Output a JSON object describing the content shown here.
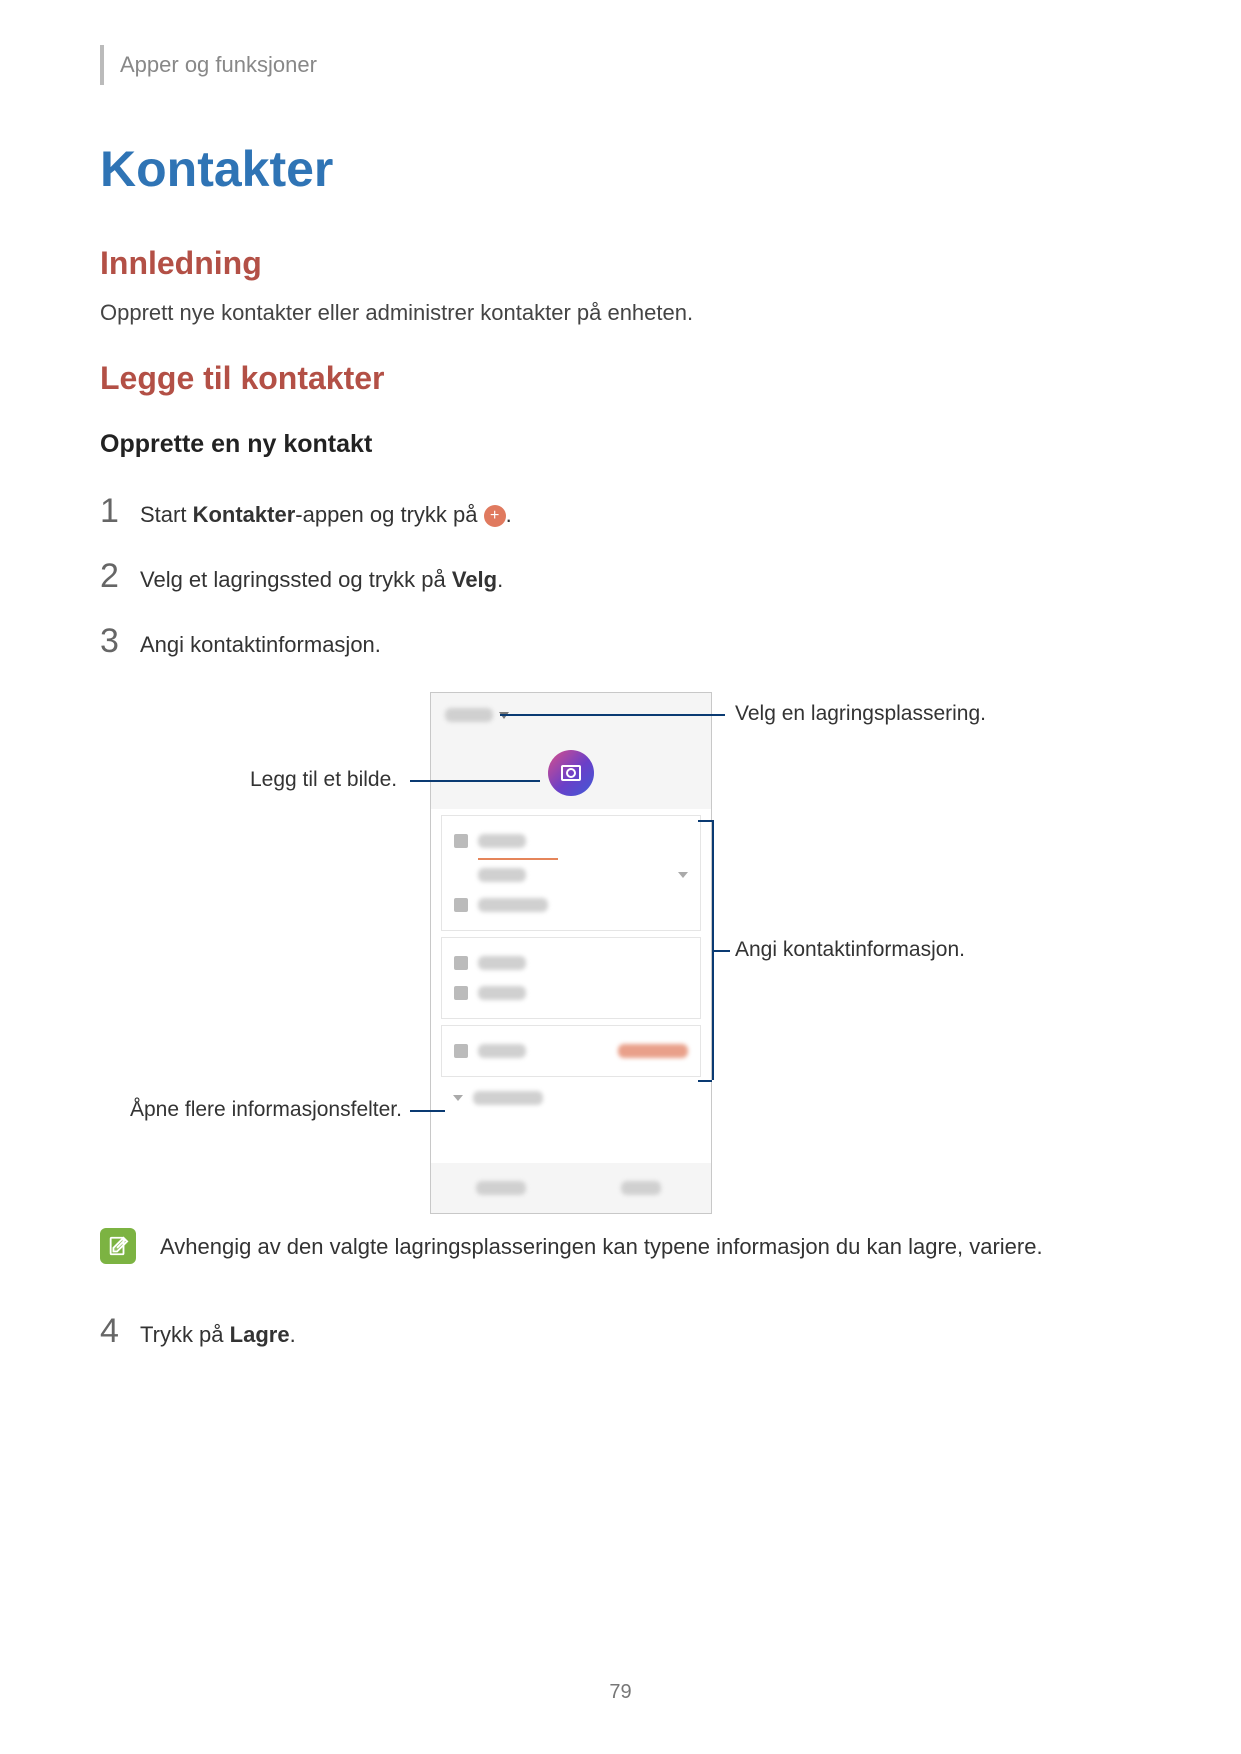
{
  "breadcrumb": "Apper og funksjoner",
  "h1": "Kontakter",
  "section_intro_heading": "Innledning",
  "intro_text": "Opprett nye kontakter eller administrer kontakter på enheten.",
  "section_add_heading": "Legge til kontakter",
  "subsection_create_heading": "Opprette en ny kontakt",
  "steps": {
    "s1_pre": "Start ",
    "s1_bold": "Kontakter",
    "s1_mid": "-appen og trykk på ",
    "s1_post": ".",
    "s2_pre": "Velg et lagringssted og trykk på ",
    "s2_bold": "Velg",
    "s2_post": ".",
    "s3": "Angi kontaktinformasjon.",
    "s4_pre": "Trykk på ",
    "s4_bold": "Lagre",
    "s4_post": "."
  },
  "callouts": {
    "storage": "Velg en lagringsplassering.",
    "image": "Legg til et bilde.",
    "info": "Angi kontaktinformasjon.",
    "more": "Åpne flere informasjonsfelter."
  },
  "note": "Avhengig av den valgte lagringsplasseringen kan typene informasjon du kan lagre, variere.",
  "page_number": "79"
}
